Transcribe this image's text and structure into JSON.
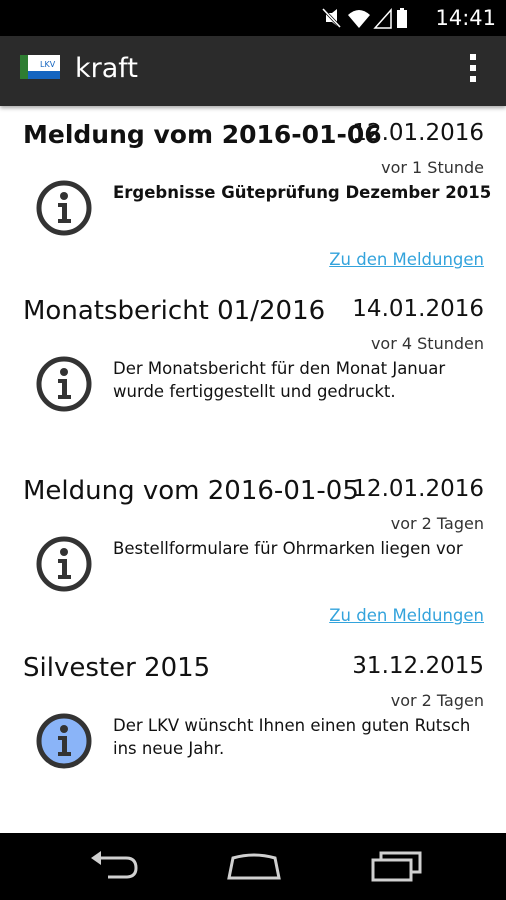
{
  "status_bar": {
    "time": "14:41"
  },
  "app_bar": {
    "logo_text": "LKV",
    "title": "kraft"
  },
  "items": [
    {
      "title": "Meldung vom 2016-01-06",
      "date": "12.01.2016",
      "ago": "vor 1 Stunde",
      "text": "Ergebnisse Güteprüfung Dezember 2015",
      "link": "Zu den Meldungen",
      "icon": "info-icon"
    },
    {
      "title": "Monatsbericht 01/2016",
      "date": "14.01.2016",
      "ago": "vor 4 Stunden",
      "text": "Der Monatsbericht für den Monat Januar wurde fertiggestellt und gedruckt.",
      "icon": "info-icon"
    },
    {
      "title": "Meldung vom 2016-01-05",
      "date": "12.01.2016",
      "ago": "vor 2 Tagen",
      "text": "Bestellformulare für Ohrmarken liegen vor",
      "link": "Zu den Meldungen",
      "icon": "info-icon"
    },
    {
      "title": "Silvester 2015",
      "date": "31.12.2015",
      "ago": "vor 2 Tagen",
      "text": "Der LKV wünscht Ihnen einen guten Rutsch ins neue Jahr.",
      "icon": "info-icon"
    }
  ],
  "colors": {
    "link": "#33a3dc",
    "highlight_icon_fill": "#8ab4f8",
    "app_bar": "#2b2b2b"
  }
}
